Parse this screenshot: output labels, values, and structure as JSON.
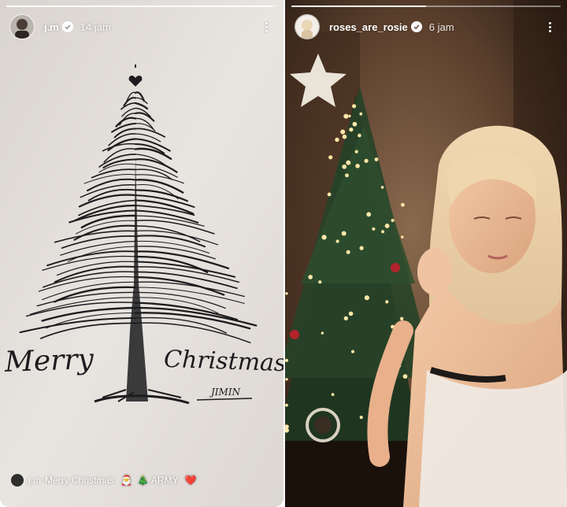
{
  "stories": [
    {
      "username": "j.m",
      "time": "14 jam",
      "progress": 0.98,
      "caption": {
        "username": "j.m",
        "text": "Merry Christmas",
        "emojis": [
          "🎅",
          "🎄",
          "❤️"
        ],
        "after_text": "ARMY"
      },
      "drawing": {
        "text_left": "Merry",
        "text_right": "Christmas",
        "signature": "JIMIN"
      }
    },
    {
      "username": "roses_are_rosie",
      "time": "6 jam",
      "progress": 0.5
    }
  ],
  "icons": {
    "verified": "verified-badge-icon",
    "more": "more-vertical-icon"
  },
  "colors": {
    "paper": "#e6e1dc",
    "ink": "#1c1c1e",
    "room": "#2a1d14",
    "accent_heart": "#e03a45"
  }
}
